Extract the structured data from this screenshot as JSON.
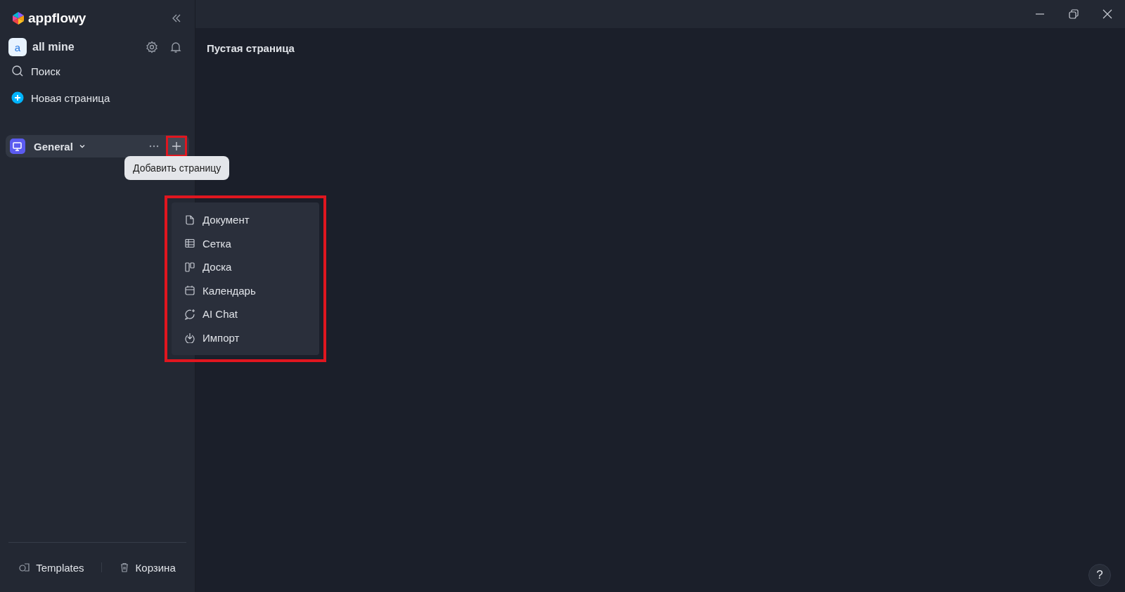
{
  "sidebar": {
    "logo": "appflowy",
    "workspace": {
      "avatar": "a",
      "name": "all mine"
    },
    "actions": [
      {
        "kind": "search",
        "label": "Поиск"
      },
      {
        "kind": "new",
        "label": "Новая страница"
      }
    ],
    "space": {
      "name": "General",
      "highlighted": true,
      "tooltip": "Добавить страницу"
    },
    "footer": [
      {
        "kind": "templates",
        "label": "Templates"
      },
      {
        "kind": "trash",
        "label": "Корзина"
      }
    ]
  },
  "page": {
    "title": "Пустая страница"
  },
  "add_menu": {
    "highlighted": true,
    "items": [
      {
        "kind": "document",
        "label": "Документ"
      },
      {
        "kind": "grid",
        "label": "Сетка"
      },
      {
        "kind": "board",
        "label": "Доска"
      },
      {
        "kind": "calendar",
        "label": "Календарь"
      },
      {
        "kind": "chat",
        "label": "AI Chat"
      },
      {
        "kind": "import",
        "label": "Импорт"
      }
    ]
  },
  "help": "?"
}
